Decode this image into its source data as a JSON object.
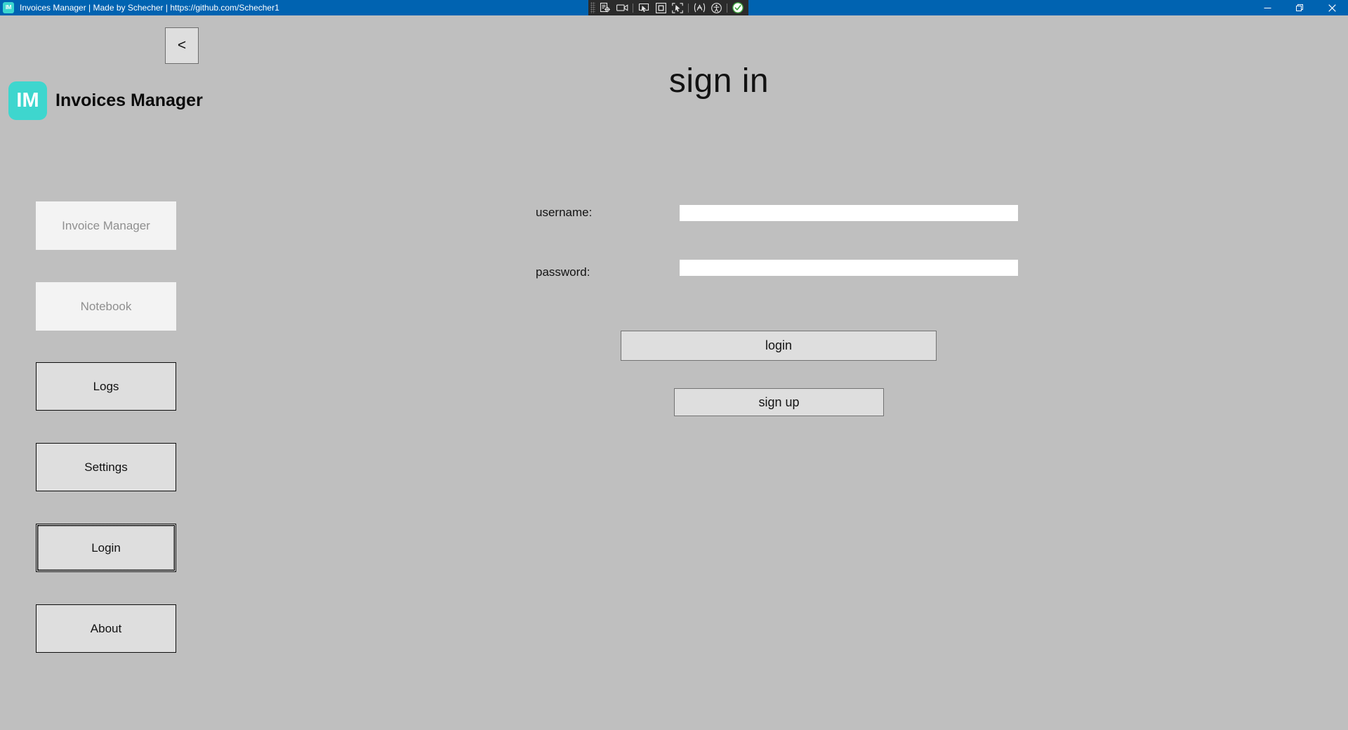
{
  "window": {
    "app_icon_text": "IM",
    "title": "Invoices Manager | Made by Schecher | https://github.com/Schecher1",
    "titlebar_color": "#0063b1",
    "controls": {
      "minimize": "minimize-icon",
      "restore": "restore-icon",
      "close": "close-icon"
    }
  },
  "capture_toolbar": {
    "background": "#2b2b2b",
    "items": [
      {
        "name": "drag-grip",
        "icon": "grip-dots-icon"
      },
      {
        "name": "capture-element",
        "icon": "capture-element-icon"
      },
      {
        "name": "record-video",
        "icon": "video-camera-icon"
      },
      {
        "name": "separator-1",
        "icon": "separator"
      },
      {
        "name": "select-cursor",
        "icon": "cursor-screen-icon"
      },
      {
        "name": "select-region",
        "icon": "square-in-square-icon"
      },
      {
        "name": "pick-element",
        "icon": "cursor-brackets-icon"
      },
      {
        "name": "separator-2",
        "icon": "separator"
      },
      {
        "name": "inspect-flow",
        "icon": "flow-zigzag-icon"
      },
      {
        "name": "accessibility",
        "icon": "accessibility-person-icon"
      },
      {
        "name": "separator-3",
        "icon": "separator"
      },
      {
        "name": "confirm",
        "icon": "green-check-circle-icon"
      }
    ],
    "accent_color": "#4caf50"
  },
  "app": {
    "back_button_label": "<",
    "brand": {
      "logo_text": "IM",
      "logo_color": "#3ed6ce",
      "name": "Invoices Manager"
    },
    "background_color": "#bfbfbf"
  },
  "sidebar": {
    "items": [
      {
        "label": "Invoice Manager",
        "state": "disabled",
        "focused": false
      },
      {
        "label": "Notebook",
        "state": "disabled",
        "focused": false
      },
      {
        "label": "Logs",
        "state": "enabled",
        "focused": false
      },
      {
        "label": "Settings",
        "state": "enabled",
        "focused": false
      },
      {
        "label": "Login",
        "state": "enabled",
        "focused": true
      },
      {
        "label": "About",
        "state": "enabled",
        "focused": false
      }
    ]
  },
  "main": {
    "heading": "sign in",
    "fields": [
      {
        "label": "username:",
        "value": "",
        "placeholder": "",
        "type": "text"
      },
      {
        "label": "password:",
        "value": "",
        "placeholder": "",
        "type": "password"
      }
    ],
    "buttons": [
      {
        "label": "login"
      },
      {
        "label": "sign up"
      }
    ]
  }
}
